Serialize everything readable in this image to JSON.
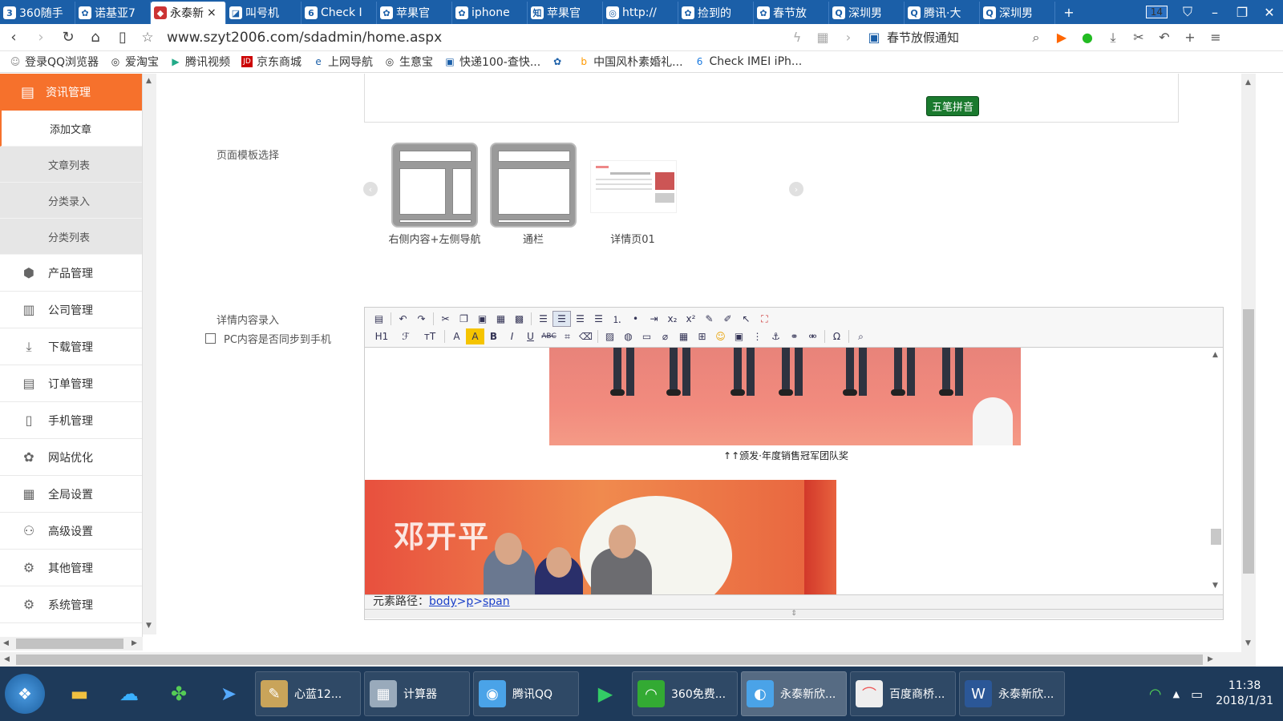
{
  "tabs": [
    {
      "label": "360随手",
      "icon": "360-icon",
      "active": false
    },
    {
      "label": "诺基亚7",
      "icon": "paw-icon",
      "active": false
    },
    {
      "label": "永泰新",
      "icon": "site-icon",
      "active": true
    },
    {
      "label": "叫号机",
      "icon": "news-icon",
      "active": false
    },
    {
      "label": "Check I",
      "icon": "check-icon",
      "active": false
    },
    {
      "label": "苹果官",
      "icon": "paw-icon",
      "active": false
    },
    {
      "label": "iphone",
      "icon": "paw-icon",
      "active": false
    },
    {
      "label": "苹果官",
      "icon": "zhihu-icon",
      "active": false
    },
    {
      "label": "http://",
      "icon": "globe-icon",
      "active": false
    },
    {
      "label": "捡到的",
      "icon": "paw-icon",
      "active": false
    },
    {
      "label": "春节放",
      "icon": "paw-icon",
      "active": false
    },
    {
      "label": "深圳男",
      "icon": "qq-icon",
      "active": false
    },
    {
      "label": "腾讯·大",
      "icon": "qq-icon",
      "active": false
    },
    {
      "label": "深圳男",
      "icon": "qq-icon",
      "active": false
    }
  ],
  "tab_count": "14",
  "address": {
    "url": "www.szyt2006.com/sdadmin/home.aspx",
    "news": "春节放假通知"
  },
  "bookmarks": [
    {
      "label": "登录QQ浏览器",
      "icon": "user-icon"
    },
    {
      "label": "爱淘宝",
      "icon": "globe-icon"
    },
    {
      "label": "腾讯视频",
      "icon": "play-icon"
    },
    {
      "label": "京东商城",
      "icon": "jd-icon"
    },
    {
      "label": "上网导航",
      "icon": "ie-icon"
    },
    {
      "label": "生意宝",
      "icon": "globe-icon"
    },
    {
      "label": "快递100-查快...",
      "icon": "express-icon"
    },
    {
      "label": "",
      "icon": "paw-icon"
    },
    {
      "label": "中国风朴素婚礼...",
      "icon": "bing-icon"
    },
    {
      "label": "Check IMEI iPh...",
      "icon": "check-icon"
    }
  ],
  "sidebar": {
    "active": {
      "label": "资讯管理",
      "icon": "news-list-icon"
    },
    "subitems": [
      {
        "label": "添加文章",
        "current": true
      },
      {
        "label": "文章列表",
        "current": false
      },
      {
        "label": "分类录入",
        "current": false
      },
      {
        "label": "分类列表",
        "current": false
      }
    ],
    "items": [
      {
        "label": "产品管理",
        "icon": "cube-icon"
      },
      {
        "label": "公司管理",
        "icon": "factory-icon"
      },
      {
        "label": "下载管理",
        "icon": "download-icon"
      },
      {
        "label": "订单管理",
        "icon": "document-icon"
      },
      {
        "label": "手机管理",
        "icon": "phone-icon"
      },
      {
        "label": "网站优化",
        "icon": "paw-icon"
      },
      {
        "label": "全局设置",
        "icon": "grid-icon"
      },
      {
        "label": "高级设置",
        "icon": "user-gear-icon"
      },
      {
        "label": "其他管理",
        "icon": "gears-icon"
      },
      {
        "label": "系统管理",
        "icon": "gear-icon"
      }
    ]
  },
  "main": {
    "ime_badge": "五笔拼音",
    "template_label": "页面模板选择",
    "templates": [
      {
        "caption": "右侧内容+左侧导航"
      },
      {
        "caption": "通栏"
      },
      {
        "caption": "详情页01"
      }
    ],
    "content_label": "详情内容录入",
    "sync_label": "PC内容是否同步到手机",
    "sync_checked": false,
    "editor": {
      "toolbar_row2_labels": {
        "heading": "H1",
        "font": "ℱ",
        "size": "тT"
      },
      "caption": "↑↑颁发·年度销售冠军团队奖",
      "photo_text": "邓开平",
      "path_label": "元素路径：",
      "path": [
        "body",
        "p",
        "span"
      ]
    }
  },
  "taskbar": {
    "tasks": [
      {
        "label": "心蓝12...",
        "icon": "ticket-icon",
        "active": false
      },
      {
        "label": "计算器",
        "icon": "calculator-icon",
        "active": false
      },
      {
        "label": "腾讯QQ",
        "icon": "qq-penguin-icon",
        "active": false
      },
      {
        "label": "360免费...",
        "icon": "wifi-icon",
        "active": false
      },
      {
        "label": "永泰新欣...",
        "icon": "qq-browser-icon",
        "active": true
      },
      {
        "label": "百度商桥...",
        "icon": "bridge-icon",
        "active": false
      },
      {
        "label": "永泰新欣...",
        "icon": "word-icon",
        "active": false
      }
    ],
    "time": "11:38",
    "date": "2018/1/31"
  },
  "colors": {
    "tab_bar": "#1b5fa8",
    "sidebar_active": "#f6712c",
    "link": "#1a3fc8",
    "taskbar": "#1e3a5a"
  }
}
